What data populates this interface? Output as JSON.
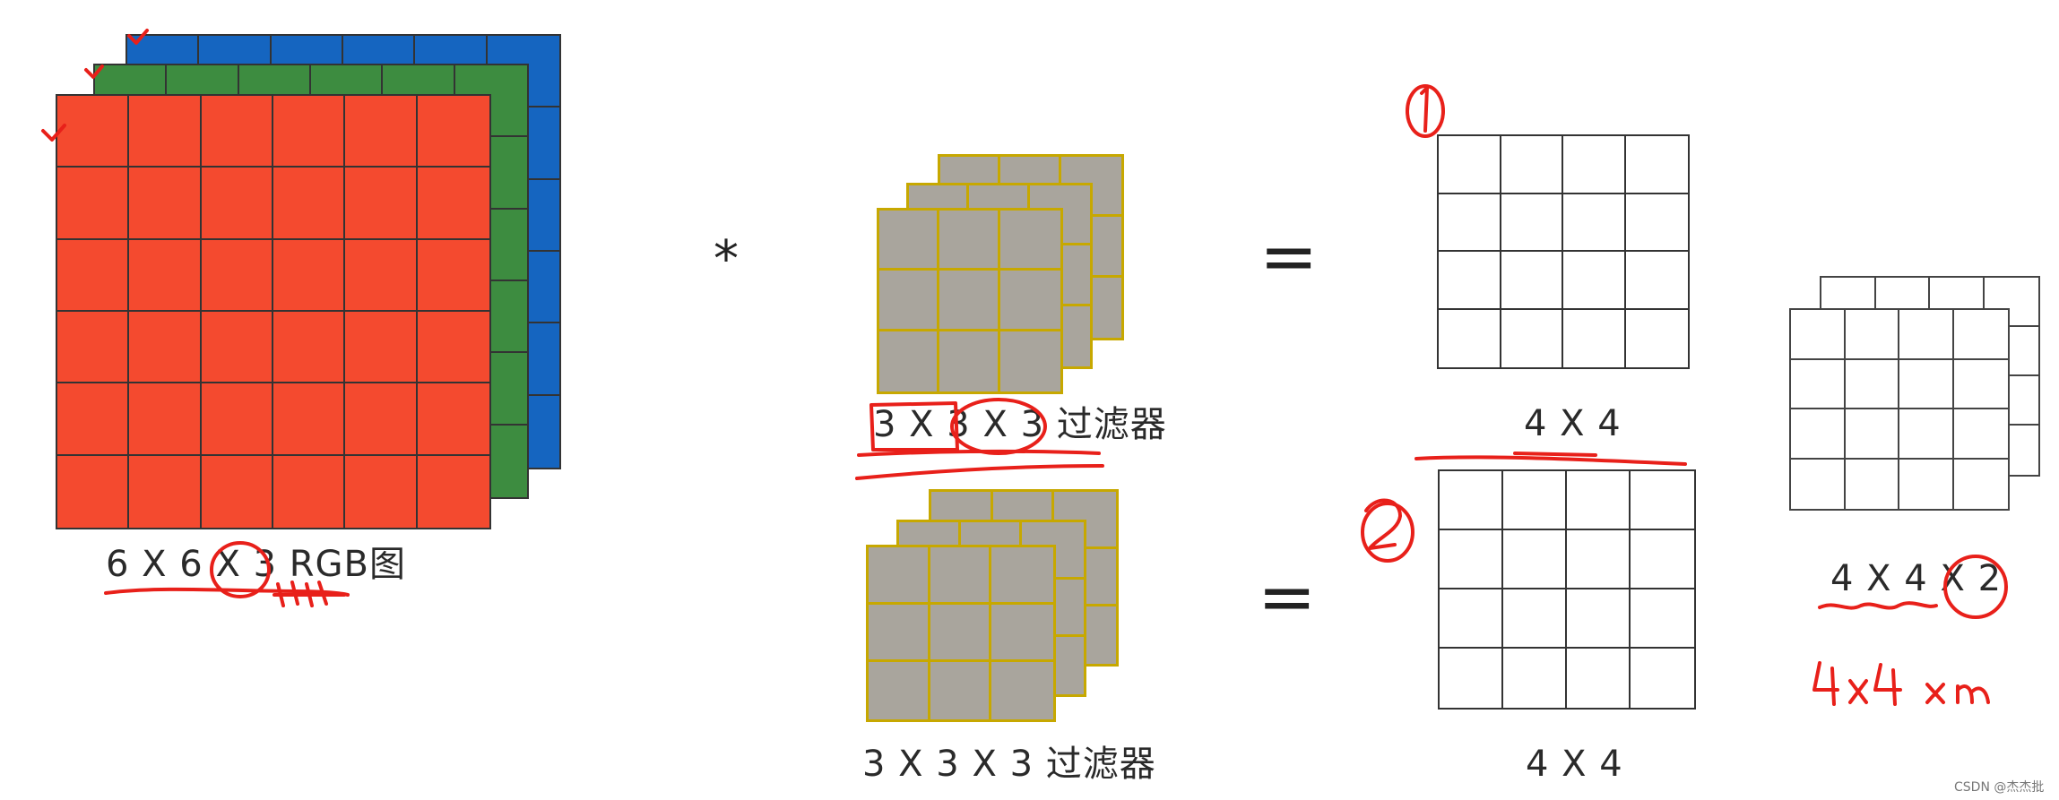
{
  "input": {
    "caption": "6 X 6  X 3 RGB图",
    "rows": 6,
    "cols": 6,
    "colors": {
      "red": "#f44a2f",
      "green": "#3d8c40",
      "blue": "#1565c0",
      "line": "#333333"
    }
  },
  "operator_convolve": "*",
  "filters": [
    {
      "caption": "3 X 3  X 3 过滤器",
      "rows": 3,
      "cols": 3,
      "fill": "#a9a59d",
      "line": "#c7a800"
    },
    {
      "caption": "3 X 3  X 3 过滤器",
      "rows": 3,
      "cols": 3,
      "fill": "#a9a59d",
      "line": "#c7a800"
    }
  ],
  "operator_equals": "=",
  "outputs": [
    {
      "caption": "4 X 4",
      "rows": 4,
      "cols": 4
    },
    {
      "caption": "4 X 4",
      "rows": 4,
      "cols": 4
    }
  ],
  "stacked_output": {
    "caption": "4 X 4 X 2",
    "rows": 4,
    "cols": 4
  },
  "annotations": {
    "number_1": "1",
    "number_2": "2",
    "handwritten_note": "4x4 ×n",
    "ink_color": "#e8201a"
  },
  "watermark": "CSDN @杰杰批"
}
